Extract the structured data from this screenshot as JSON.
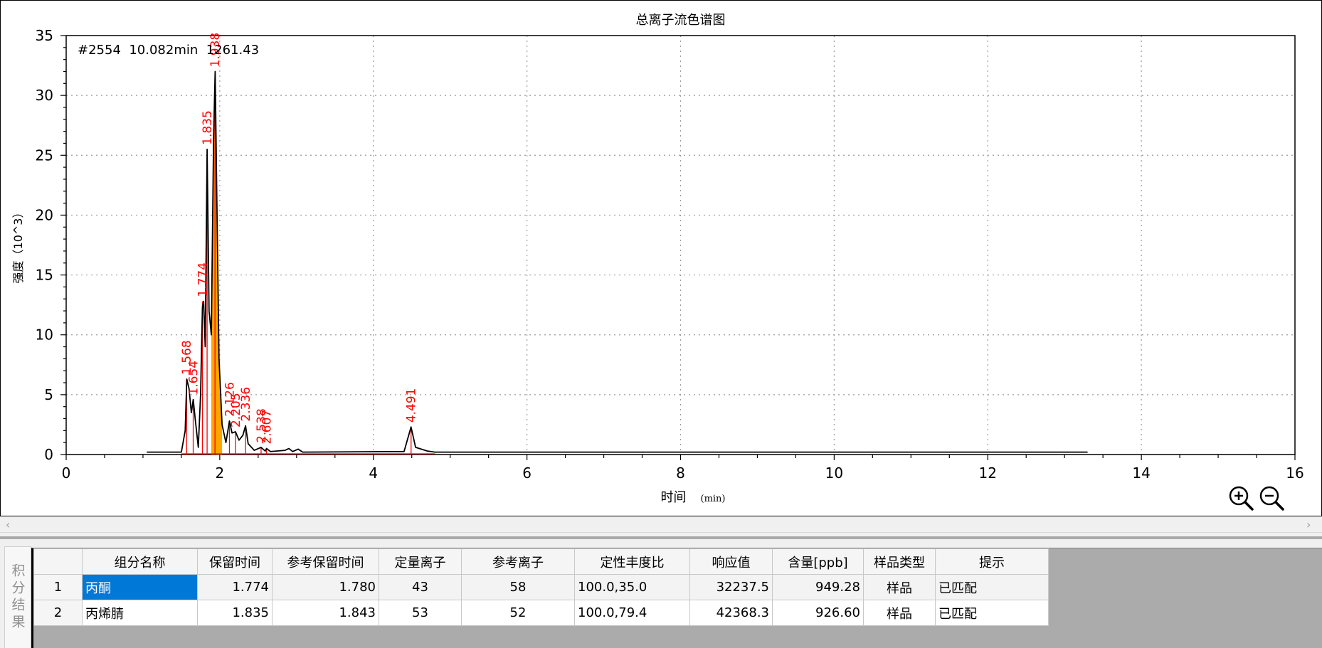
{
  "chart_data": {
    "type": "line",
    "title": "总离子流色谱图",
    "xlabel": "时间",
    "xlabel_unit": "(min)",
    "ylabel": "强度（10^3）",
    "xlim": [
      0,
      16
    ],
    "ylim": [
      0,
      35
    ],
    "x_ticks": [
      "0",
      "2",
      "4",
      "6",
      "8",
      "10",
      "12",
      "14",
      "16"
    ],
    "y_ticks": [
      "0",
      "5",
      "10",
      "15",
      "20",
      "25",
      "30",
      "35"
    ],
    "grid": true,
    "info_text": "#2554  10.082min  1261.43",
    "series": [
      {
        "color": "#000000",
        "points": [
          [
            1.05,
            0.2
          ],
          [
            1.5,
            0.2
          ],
          [
            1.55,
            2.0
          ],
          [
            1.57,
            6.3
          ],
          [
            1.6,
            5.5
          ],
          [
            1.63,
            3.5
          ],
          [
            1.655,
            4.6
          ],
          [
            1.68,
            3.0
          ],
          [
            1.72,
            0.6
          ],
          [
            1.75,
            5.0
          ],
          [
            1.774,
            12.3
          ],
          [
            1.79,
            12.8
          ],
          [
            1.81,
            9.0
          ],
          [
            1.835,
            25.5
          ],
          [
            1.86,
            12.0
          ],
          [
            1.89,
            10.0
          ],
          [
            1.92,
            26.5
          ],
          [
            1.94,
            32.0
          ],
          [
            1.96,
            22.0
          ],
          [
            1.99,
            8.0
          ],
          [
            2.03,
            2.5
          ],
          [
            2.08,
            1.0
          ],
          [
            2.126,
            2.8
          ],
          [
            2.16,
            1.8
          ],
          [
            2.205,
            1.9
          ],
          [
            2.25,
            1.2
          ],
          [
            2.3,
            1.6
          ],
          [
            2.336,
            2.4
          ],
          [
            2.37,
            0.9
          ],
          [
            2.45,
            0.35
          ],
          [
            2.538,
            0.6
          ],
          [
            2.59,
            0.3
          ],
          [
            2.61,
            0.5
          ],
          [
            2.66,
            0.25
          ],
          [
            2.85,
            0.35
          ],
          [
            2.9,
            0.5
          ],
          [
            2.95,
            0.25
          ],
          [
            3.02,
            0.45
          ],
          [
            3.08,
            0.2
          ],
          [
            4.4,
            0.25
          ],
          [
            4.491,
            2.3
          ],
          [
            4.55,
            0.6
          ],
          [
            4.7,
            0.3
          ],
          [
            4.8,
            0.2
          ],
          [
            13.3,
            0.2
          ]
        ]
      }
    ],
    "filled_peak": {
      "color": "#ffa500",
      "x_from": 1.89,
      "x_to": 2.05
    },
    "peak_labels": [
      {
        "x": 1.568,
        "label": "1.568",
        "y": 6.3
      },
      {
        "x": 1.654,
        "label": "1.654",
        "y": 4.6
      },
      {
        "x": 1.774,
        "label": "1.774",
        "y": 12.8
      },
      {
        "x": 1.835,
        "label": "1.835",
        "y": 25.5
      },
      {
        "x": 1.938,
        "label": "1.938",
        "y": 32.0
      },
      {
        "x": 2.126,
        "label": "2.126",
        "y": 2.8
      },
      {
        "x": 2.205,
        "label": "2.205",
        "y": 1.9
      },
      {
        "x": 2.336,
        "label": "2.336",
        "y": 2.4
      },
      {
        "x": 2.538,
        "label": "2.538",
        "y": 0.6
      },
      {
        "x": 2.607,
        "label": "2.607",
        "y": 0.5
      },
      {
        "x": 4.491,
        "label": "4.491",
        "y": 2.3
      }
    ],
    "peak_label_color": "#ff0000"
  },
  "icons": {
    "zoom_in": "zoom-in-icon",
    "zoom_out": "zoom-out-icon"
  },
  "side_tab_label": "积分结果",
  "table": {
    "headers": [
      "组分名称",
      "保留时间",
      "参考保留时间",
      "定量离子",
      "参考离子",
      "定性丰度比",
      "响应值",
      "含量[ppb]",
      "样品类型",
      "提示"
    ],
    "rows": [
      {
        "index": "1",
        "name": "丙酮",
        "rt": "1.774",
        "ref_rt": "1.780",
        "quant_ion": "43",
        "ref_ion": "58",
        "ratio": "100.0,35.0",
        "response": "32237.5",
        "amount": "949.28",
        "sample_type": "样品",
        "hint": "已匹配"
      },
      {
        "index": "2",
        "name": "丙烯腈",
        "rt": "1.835",
        "ref_rt": "1.843",
        "quant_ion": "53",
        "ref_ion": "52",
        "ratio": "100.0,79.4",
        "response": "42368.3",
        "amount": "926.60",
        "sample_type": "样品",
        "hint": "已匹配"
      }
    ]
  }
}
